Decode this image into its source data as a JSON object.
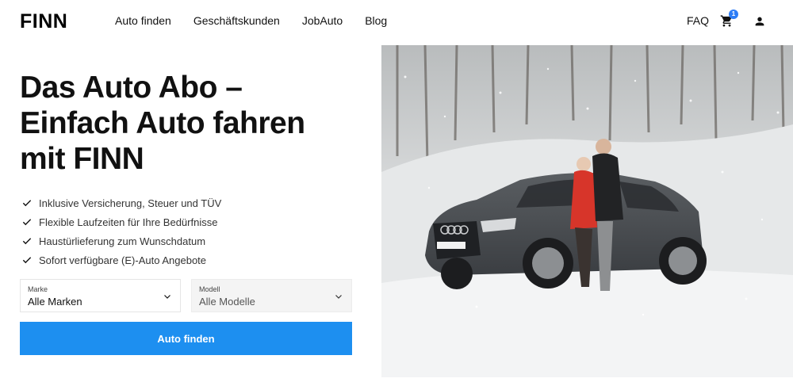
{
  "header": {
    "logo": "FINN",
    "nav": [
      {
        "label": "Auto finden"
      },
      {
        "label": "Geschäftskunden"
      },
      {
        "label": "JobAuto"
      },
      {
        "label": "Blog"
      }
    ],
    "faq_label": "FAQ",
    "cart_count": "1",
    "cart_icon": "cart-icon",
    "user_icon": "user-icon",
    "accent_color": "#2d7df6"
  },
  "hero": {
    "title_line1": "Das Auto Abo –",
    "title_line2": "Einfach Auto fahren",
    "title_line3": "mit FINN",
    "features": [
      {
        "text": "Inklusive Versicherung, Steuer und TÜV"
      },
      {
        "text": "Flexible Laufzeiten für Ihre Bedürfnisse"
      },
      {
        "text": "Haustürlieferung zum Wunschdatum"
      },
      {
        "text": "Sofort verfügbare (E)-Auto Angebote"
      }
    ],
    "brand_select": {
      "label": "Marke",
      "value": "Alle Marken"
    },
    "model_select": {
      "label": "Modell",
      "value": "Alle Modelle"
    },
    "cta_label": "Auto finden",
    "cta_color": "#1d8ff0"
  }
}
